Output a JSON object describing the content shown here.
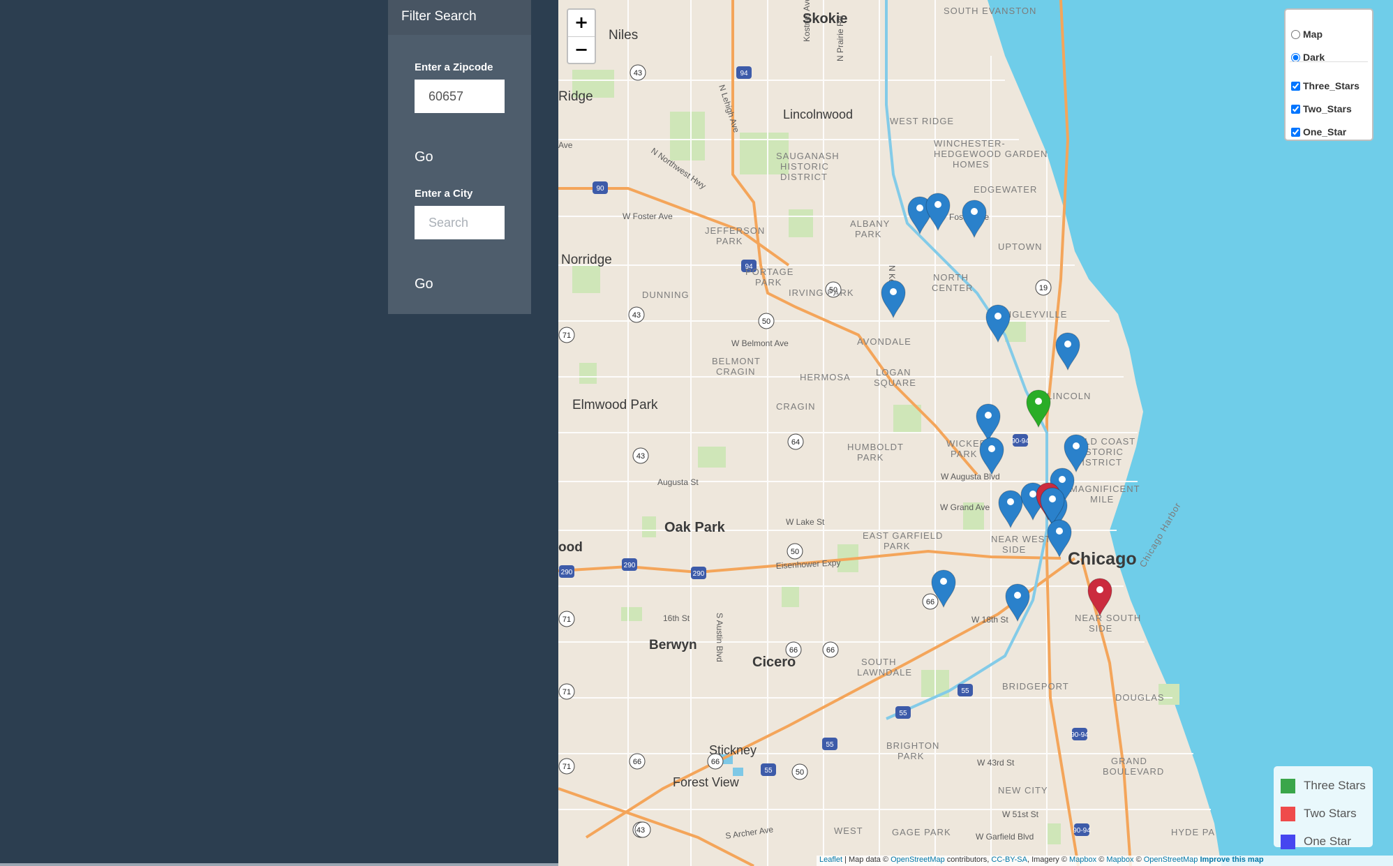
{
  "filter": {
    "title": "Filter Search",
    "zipcode_label": "Enter a Zipcode",
    "zipcode_value": "60657",
    "zipcode_go": "Go",
    "city_label": "Enter a City",
    "city_placeholder": "Search",
    "city_go": "Go"
  },
  "map": {
    "zoom_in": "+",
    "zoom_out": "−",
    "base_layers": [
      {
        "label": "Map",
        "checked": false
      },
      {
        "label": "Dark",
        "checked": true
      }
    ],
    "overlays": [
      {
        "label": "Three_Stars",
        "checked": true
      },
      {
        "label": "Two_Stars",
        "checked": true
      },
      {
        "label": "One_Star",
        "checked": true
      }
    ],
    "legend": [
      {
        "label": "Three Stars",
        "color": "#3aa64a"
      },
      {
        "label": "Two Stars",
        "color": "#ef4b4b"
      },
      {
        "label": "One Star",
        "color": "#4646f0"
      }
    ],
    "attribution": {
      "leaflet": "Leaflet",
      "text1": " | Map data © ",
      "osm": "OpenStreetMap",
      "text2": " contributors, ",
      "ccbysa": "CC-BY-SA",
      "text3": ", Imagery © ",
      "mapbox": "Mapbox",
      "text4": " © ",
      "mapbox2": "Mapbox",
      "text5": " © ",
      "osm2": "OpenStreetMap",
      "improve": "Improve this map"
    },
    "places": {
      "skokie": "Skokie",
      "niles": "Niles",
      "south_evanston": "SOUTH EVANSTON",
      "lincolnwood": "Lincolnwood",
      "ridge": "Ridge",
      "norridge": "Norridge",
      "elmwood_park": "Elmwood Park",
      "oak_park": "Oak Park",
      "berwyn": "Berwyn",
      "cicero": "Cicero",
      "stickney": "Stickney",
      "forest_view": "Forest View",
      "chicago": "Chicago",
      "wood": "ood",
      "west_ridge": "WEST RIDGE",
      "winchester1": "WINCHESTER-",
      "winchester2": "HEDGEWOOD GARDEN",
      "winchester3": "HOMES",
      "edgewater": "EDGEWATER",
      "sauganash1": "SAUGANASH",
      "sauganash2": "HISTORIC",
      "sauganash3": "DISTRICT",
      "albany1": "ALBANY",
      "albany2": "PARK",
      "jefferson1": "JEFFERSON",
      "jefferson2": "PARK",
      "uptown": "UPTOWN",
      "portage1": "PORTAGE",
      "portage2": "PARK",
      "north1": "NORTH",
      "north2": "CENTER",
      "irving": "IRVING PARK",
      "dunning": "DUNNING",
      "wrigleyville": "WRIGLEYVILLE",
      "avondale": "AVONDALE",
      "belmont1": "BELMONT",
      "belmont2": "CRAGIN",
      "hermosa": "HERMOSA",
      "logan1": "LOGAN",
      "logan2": "SQUARE",
      "lincoln": "LINCOLN",
      "cragin": "CRAGIN",
      "humboldt1": "HUMBOLDT",
      "humboldt2": "PARK",
      "wicker1": "WICKER",
      "wicker2": "PARK",
      "gold1": "GOLD COAST",
      "gold2": "HISTORIC",
      "gold3": "DISTRICT",
      "mag1": "MAGNIFICENT",
      "mag2": "MILE",
      "eg1": "EAST GARFIELD",
      "eg2": "PARK",
      "nws1": "NEAR WEST",
      "nws2": "SIDE",
      "nss1": "NEAR SOUTH",
      "nss2": "SIDE",
      "sl1": "SOUTH",
      "sl2": "LAWNDALE",
      "bridgeport": "BRIDGEPORT",
      "douglas": "DOUGLAS",
      "grand1": "GRAND",
      "grand2": "BOULEVARD",
      "brighton1": "BRIGHTON",
      "brighton2": "PARK",
      "newcity": "NEW CITY",
      "gage": "GAGE PARK",
      "hyde": "HYDE PA",
      "west_lawn": "WEST",
      "harbor": "Chicago Harbor",
      "foster": "W Foster Ave",
      "belmont_ave": "W Belmont Ave",
      "augusta": "Augusta St",
      "w_augusta": "W Augusta Blvd",
      "grand_ave": "W Grand Ave",
      "lake": "W Lake St",
      "eisenhower": "Eisenhower Expy",
      "sixteenth": "16th St",
      "eighteenth": "W 18th St",
      "fortythird": "W 43rd St",
      "fiftyfirst": "W 51st St",
      "garfield": "W Garfield Blvd",
      "archer": "S Archer Ave",
      "ave": "Ave",
      "nw_hwy": "N Northwest Hwy",
      "lehigh": "N Lehigh Ave",
      "kostner": "Kostner Ave",
      "prairie": "N Prairie Rd",
      "austin": "S Austin Blvd",
      "nked": "N Ked",
      "fostave": "Foster Ave"
    }
  }
}
